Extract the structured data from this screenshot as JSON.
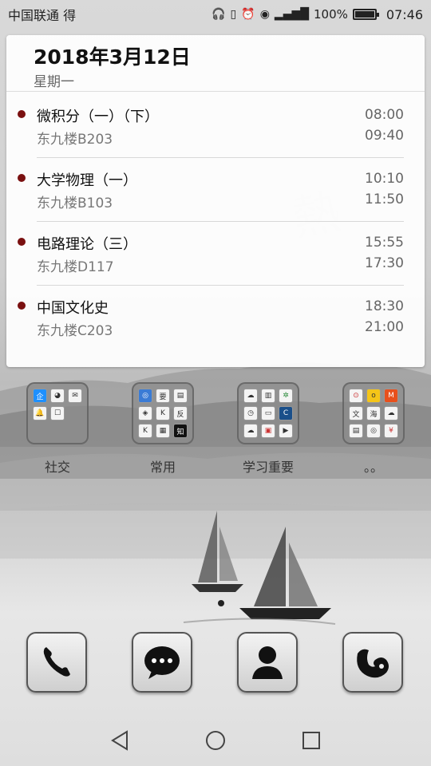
{
  "status_bar": {
    "carrier": "中国联通 得",
    "icons": [
      "headphone-icon",
      "vibrate-icon",
      "alarm-icon",
      "eye-icon",
      "signal-4g-icon"
    ],
    "battery_percent": "100%",
    "battery_level": 1.0,
    "time": "07:46"
  },
  "schedule": {
    "date": "2018年3月12日",
    "weekday": "星期一",
    "courses": [
      {
        "name": "微积分（一）（下）",
        "room": "东九楼B203",
        "start": "08:00",
        "end": "09:40"
      },
      {
        "name": "大学物理（一）",
        "room": "东九楼B103",
        "start": "10:10",
        "end": "11:50"
      },
      {
        "name": "电路理论（三）",
        "room": "东九楼D117",
        "start": "15:55",
        "end": "17:30"
      },
      {
        "name": "中国文化史",
        "room": "东九楼C203",
        "start": "18:30",
        "end": "21:00"
      }
    ],
    "accent_color": "#7a1010"
  },
  "folders": [
    {
      "label": "社交",
      "apps": [
        "qq-icon",
        "wechat-icon",
        "mail-icon",
        "qq-bell-icon",
        "message-icon"
      ]
    },
    {
      "label": "常用",
      "apps": [
        "baidu-icon",
        "lecture-icon",
        "phone-icon",
        "taobao-icon",
        "kuwo-icon",
        "fan-icon",
        "k-icon",
        "calendar-icon",
        "zhihu-icon"
      ]
    },
    {
      "label": "学习重要",
      "apps": [
        "cloud-icon",
        "office-icon",
        "tree-icon",
        "music-icon",
        "book-icon",
        "china-daily-icon",
        "cloud-drive-icon",
        "pdf-icon",
        "video-icon"
      ]
    },
    {
      "label": "。。",
      "apps": [
        "bike-icon",
        "ofo-icon",
        "ticket-icon",
        "text-icon",
        "hai-icon",
        "cloud-icon",
        "memo-icon",
        "wheel-icon",
        "yen-icon"
      ]
    }
  ],
  "dock": [
    {
      "name": "phone-app",
      "icon": "phone-icon"
    },
    {
      "name": "messages-app",
      "icon": "chat-bubble-icon"
    },
    {
      "name": "contacts-app",
      "icon": "person-icon"
    },
    {
      "name": "uc-browser-app",
      "icon": "squirrel-icon"
    }
  ],
  "navbar": {
    "icons": [
      "back-icon",
      "home-icon",
      "recents-icon"
    ]
  },
  "colors": {
    "background_ink": "#3a3a3a",
    "widget_bg": "#ffffff"
  }
}
